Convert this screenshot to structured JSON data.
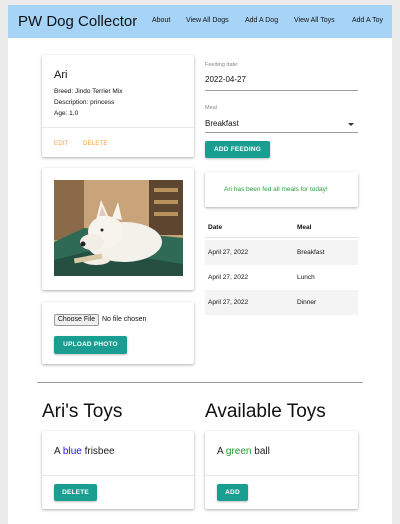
{
  "navbar": {
    "brand": "PW Dog Collector",
    "links": [
      "About",
      "View All Dogs",
      "Add A Dog",
      "View All Toys",
      "Add A Toy"
    ]
  },
  "dog_card": {
    "name": "Ari",
    "breed": "Breed: Jindo Terrier Mix",
    "description": "Description: princess",
    "age": "Age: 1.0",
    "edit_label": "EDIT",
    "delete_label": "DELETE"
  },
  "upload": {
    "choose_file_label": "Choose File",
    "no_file_text": "No file chosen",
    "upload_button": "UPLOAD PHOTO"
  },
  "feeding_form": {
    "date_label": "Feeding date:",
    "date_value": "2022-04-27",
    "meal_label": "Meal",
    "meal_value": "Breakfast",
    "submit_label": "ADD FEEDING"
  },
  "fed_message": "Ari has been fed all meals for today!",
  "feedings_table": {
    "headers": [
      "Date",
      "Meal"
    ],
    "rows": [
      [
        "April 27, 2022",
        "Breakfast"
      ],
      [
        "April 27, 2022",
        "Lunch"
      ],
      [
        "April 27, 2022",
        "Dinner"
      ]
    ]
  },
  "dogs_toys": {
    "heading": "Ari's Toys",
    "toy": {
      "prefix": "A",
      "color": "blue",
      "item": "frisbee"
    },
    "button": "DELETE"
  },
  "available_toys": {
    "heading": "Available Toys",
    "toy": {
      "prefix": "A",
      "color": "green",
      "item": "ball"
    },
    "button": "ADD"
  },
  "colors": {
    "navbar": "#a6d4f7",
    "accent_button": "#1a9e91",
    "link_orange": "#f5a142",
    "fed_green": "#2a9d3a",
    "toy_blue": "#1a1aff",
    "toy_green": "#1f9a2a"
  }
}
